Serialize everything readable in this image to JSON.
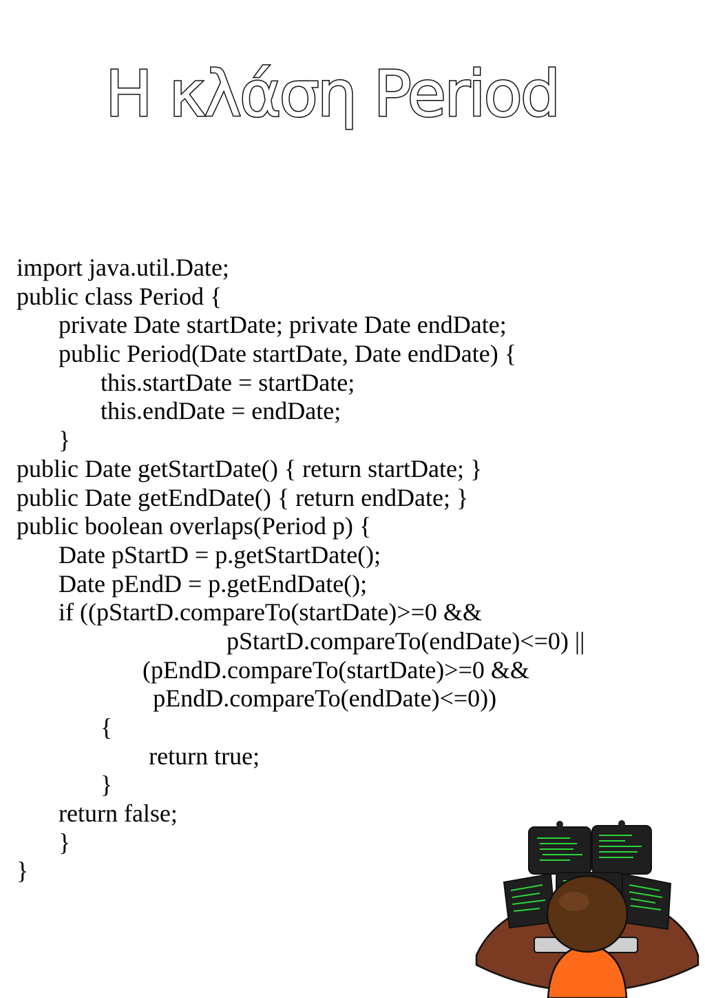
{
  "document": {
    "title": "Η κλάση Period",
    "code_lines": [
      {
        "indent": 0,
        "text": "import java.util.Date;"
      },
      {
        "indent": 0,
        "text": "public class Period {"
      },
      {
        "indent": 1,
        "text": "private Date startDate; private Date endDate;"
      },
      {
        "indent": 1,
        "text": "public Period(Date startDate, Date endDate) {"
      },
      {
        "indent": 2,
        "text": "this.startDate = startDate;"
      },
      {
        "indent": 2,
        "text": "this.endDate = endDate;"
      },
      {
        "indent": 1,
        "text": "}"
      },
      {
        "indent": 0,
        "text": "public Date getStartDate() { return startDate; }"
      },
      {
        "indent": 0,
        "text": "public Date getEndDate() { return endDate; }"
      },
      {
        "indent": 0,
        "text": "public boolean overlaps(Period p) {"
      },
      {
        "indent": 1,
        "text": "Date pStartD = p.getStartDate();"
      },
      {
        "indent": 1,
        "text": "Date pEndD = p.getEndDate();"
      },
      {
        "indent": 1,
        "text": "if ((pStartD.compareTo(startDate)>=0 &&"
      },
      {
        "indent": 5,
        "text": "pStartD.compareTo(endDate)<=0) ||"
      },
      {
        "indent": 3,
        "text": "(pEndD.compareTo(startDate)>=0 &&"
      },
      {
        "indent": 3.25,
        "text": "pEndD.compareTo(endDate)<=0))"
      },
      {
        "indent": 2,
        "text": "{"
      },
      {
        "indent": 3.15,
        "text": "return true;"
      },
      {
        "indent": 2,
        "text": "}"
      },
      {
        "indent": 1,
        "text": "return false;"
      },
      {
        "indent": 1,
        "text": "}"
      },
      {
        "indent": 0,
        "text": "}"
      }
    ]
  },
  "illustration": {
    "icon": "programmer-at-monitors-icon",
    "colors": {
      "desk": "#7a3b22",
      "monitor": "#1f1f1f",
      "code_text": "#2bd43b",
      "hair": "#5a3214",
      "shirt": "#ff6a1a",
      "keyboard": "#cfcfcf"
    }
  }
}
